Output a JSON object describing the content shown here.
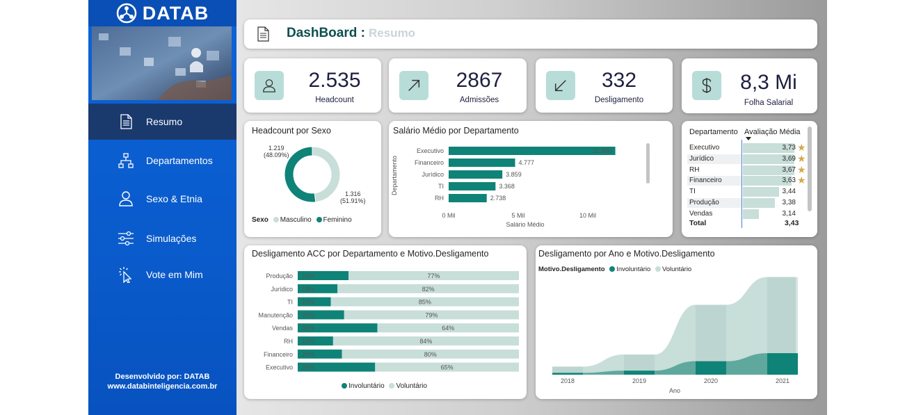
{
  "brand": {
    "name": "DATAB"
  },
  "sidebar": {
    "items": [
      {
        "label": "Resumo",
        "icon": "document-icon"
      },
      {
        "label": "Departamentos",
        "icon": "org-chart-icon"
      },
      {
        "label": "Sexo & Etnia",
        "icon": "person-icon"
      },
      {
        "label": "Simulações",
        "icon": "sliders-icon"
      },
      {
        "label": "Vote em Mim",
        "icon": "cursor-click-icon"
      }
    ],
    "active": "Resumo",
    "credits_line1": "Desenvolvido por: DATAB",
    "credits_line2": "www.databinteligencia.com.br"
  },
  "header": {
    "title": "DashBoard :",
    "subtitle": "Resumo"
  },
  "kpis": [
    {
      "value": "2.535",
      "label": "Headcount",
      "icon": "person-icon"
    },
    {
      "value": "2867",
      "label": "Admissões",
      "icon": "arrow-up-right-icon"
    },
    {
      "value": "332",
      "label": "Desligamento",
      "icon": "arrow-down-left-icon"
    },
    {
      "value": "8,3 Mi",
      "label": "Folha Salarial",
      "icon": "dollar-icon"
    }
  ],
  "colors": {
    "teal": "#0f8377",
    "light_teal": "#c8ded9",
    "accent_blue": "#0c63d6",
    "star": "#d4a84a"
  },
  "chart_data": [
    {
      "type": "pie",
      "title": "Headcount por Sexo",
      "legend_title": "Sexo",
      "series": [
        {
          "name": "Masculino",
          "value": 1219,
          "label": "1.219",
          "pct": "(48.09%)"
        },
        {
          "name": "Feminino",
          "value": 1316,
          "label": "1.316",
          "pct": "(51.91%)"
        }
      ]
    },
    {
      "type": "bar",
      "title": "Salário Médio por Departamento",
      "ylabel": "Departamento",
      "xlabel": "Salário Médio",
      "categories": [
        "Executivo",
        "Financeiro",
        "Jurídico",
        "TI",
        "RH"
      ],
      "values": [
        11980,
        4777,
        3859,
        3368,
        2738
      ],
      "value_labels": [
        "11.980",
        "4.777",
        "3.859",
        "3.368",
        "2.738"
      ],
      "xticks": [
        "0 Mil",
        "5 Mil",
        "10 Mil"
      ],
      "xlim": [
        0,
        12500
      ]
    },
    {
      "type": "table",
      "columns": [
        "Departamento",
        "Avaliação Média"
      ],
      "rows": [
        {
          "dept": "Executivo",
          "score": "3,73",
          "star": true,
          "value": 3.73
        },
        {
          "dept": "Jurídico",
          "score": "3,69",
          "star": true,
          "value": 3.69
        },
        {
          "dept": "RH",
          "score": "3,67",
          "star": true,
          "value": 3.67
        },
        {
          "dept": "Financeiro",
          "score": "3,63",
          "star": true,
          "value": 3.63
        },
        {
          "dept": "TI",
          "score": "3,44",
          "star": false,
          "value": 3.44
        },
        {
          "dept": "Produção",
          "score": "3,38",
          "star": false,
          "value": 3.38
        },
        {
          "dept": "Vendas",
          "score": "3,14",
          "star": false,
          "value": 3.14
        }
      ],
      "total_label": "Total",
      "total_value": "3,43"
    },
    {
      "type": "bar",
      "title": "Desligamento ACC por Departamento e Motivo.Desligamento",
      "categories": [
        "Produção",
        "Jurídico",
        "TI",
        "Manutenção",
        "Vendas",
        "RH",
        "Financeiro",
        "Executivo"
      ],
      "series": [
        {
          "name": "Involuntário",
          "values": [
            23,
            18,
            15,
            21,
            36,
            16,
            20,
            35
          ],
          "labels": [
            "23%",
            "18%",
            "15%",
            "21%",
            "36%",
            "16%",
            "20%",
            "35%"
          ]
        },
        {
          "name": "Voluntário",
          "values": [
            77,
            82,
            85,
            79,
            64,
            84,
            80,
            65
          ],
          "labels": [
            "77%",
            "82%",
            "85%",
            "79%",
            "64%",
            "84%",
            "80%",
            "65%"
          ]
        }
      ],
      "stacked": "percent"
    },
    {
      "type": "area",
      "title": "Desligamento por Ano e Motivo.Desligamento",
      "legend_title": "Motivo.Desligamento",
      "xlabel": "Ano",
      "x": [
        "2018",
        "2019",
        "2020",
        "2021"
      ],
      "series": [
        {
          "name": "Involuntário",
          "values": [
            4,
            9,
            30,
            48
          ]
        },
        {
          "name": "Voluntário",
          "values": [
            14,
            36,
            126,
            170
          ]
        }
      ],
      "stacked": true
    }
  ]
}
